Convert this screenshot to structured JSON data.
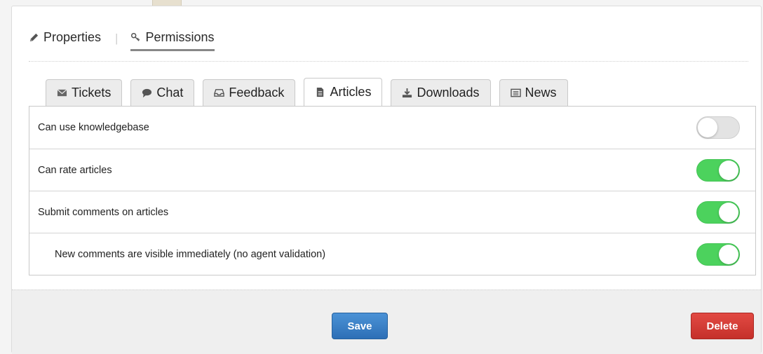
{
  "header": {
    "tabs": [
      {
        "label": "Properties",
        "icon": "pencil-icon",
        "active": false
      },
      {
        "label": "Permissions",
        "icon": "key-icon",
        "active": true
      }
    ],
    "separator": "|"
  },
  "subtabs": [
    {
      "label": "Tickets",
      "icon": "envelope-icon",
      "active": false
    },
    {
      "label": "Chat",
      "icon": "speech-bubble-icon",
      "active": false
    },
    {
      "label": "Feedback",
      "icon": "inbox-icon",
      "active": false
    },
    {
      "label": "Articles",
      "icon": "document-icon",
      "active": true
    },
    {
      "label": "Downloads",
      "icon": "download-icon",
      "active": false
    },
    {
      "label": "News",
      "icon": "newspaper-icon",
      "active": false
    }
  ],
  "permissions": [
    {
      "label": "Can use knowledgebase",
      "enabled": false,
      "indent": false
    },
    {
      "label": "Can rate articles",
      "enabled": true,
      "indent": false
    },
    {
      "label": "Submit comments on articles",
      "enabled": true,
      "indent": false
    },
    {
      "label": "New comments are visible immediately (no agent validation)",
      "enabled": true,
      "indent": true
    }
  ],
  "footer": {
    "save_label": "Save",
    "delete_label": "Delete"
  },
  "colors": {
    "toggle_on": "#4cd25d",
    "toggle_off": "#e3e3e3",
    "save": "#337ab7",
    "delete": "#d9372f"
  }
}
